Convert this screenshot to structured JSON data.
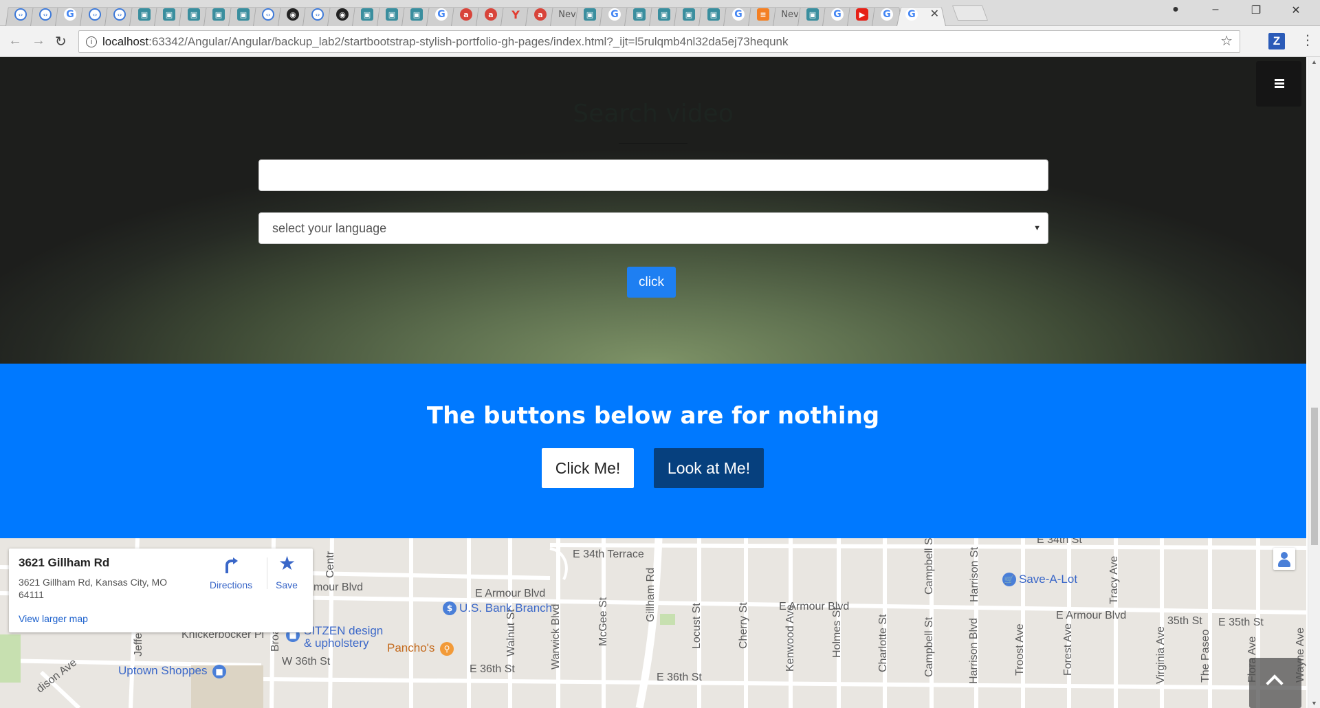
{
  "browser": {
    "tabs_count": 36,
    "tab_icons": [
      "code",
      "code",
      "g",
      "code",
      "code",
      "img",
      "img",
      "img",
      "img",
      "img",
      "code",
      "github",
      "code",
      "github",
      "img",
      "img",
      "img",
      "g",
      "avast",
      "avast",
      "y",
      "avast",
      "new",
      "img",
      "g",
      "img",
      "img",
      "img",
      "img",
      "g",
      "so",
      "new",
      "img",
      "g",
      "youtube",
      "g"
    ],
    "new_tab_label": "Nev",
    "active_tab_close": "✕",
    "url_host": "localhost",
    "url_path": ":63342/Angular/Angular/backup_lab2/startbootstrap-stylish-portfolio-gh-pages/index.html?_ijt=l5rulqmb4nl32da5ej73hequnk",
    "extension_label": "Z"
  },
  "search": {
    "title": "Search video",
    "input_value": "",
    "language_select": "select your language",
    "submit_label": "click"
  },
  "cta": {
    "headline": "The buttons below are for nothing",
    "button_primary": "Click Me!",
    "button_secondary": "Look at Me!"
  },
  "map": {
    "place_name": "3621 Gillham Rd",
    "place_address": "3621 Gillham Rd, Kansas City, MO 64111",
    "view_larger": "View larger map",
    "directions_label": "Directions",
    "save_label": "Save",
    "streets": {
      "e34terrace": "E 34th Terrace",
      "e34st": "E 34th St",
      "armour1": "E Armour Blvd",
      "armour2": "E Armour Blvd",
      "armour3": "E Armour Blvd",
      "armour_left": "mour Blvd",
      "e35st_a": "35th St",
      "e35st_b": "E 35th St",
      "w36st": "W 36th St",
      "e36st": "E 36th St",
      "e36st_b": "E 36th St",
      "knickerbocker": "Knickerbocker Pl",
      "jefferson": "Jefferson",
      "broadway": "Broadwa",
      "central": "Centr",
      "walnut": "Walnut St",
      "warwick": "Warwick Blvd",
      "mcgee": "McGee St",
      "gillham": "Gillham Rd",
      "locust": "Locust St",
      "cherry": "Cherry St",
      "kenwood": "Kenwood Ave",
      "holmes": "Holmes St",
      "charlotte": "Charlotte St",
      "campbell": "Campbell St",
      "campbell2": "Campbell S",
      "harrison_blvd": "Harrison Blvd",
      "harrison_st": "Harrison St",
      "troost": "Troost Ave",
      "forest": "Forest Ave",
      "tracy": "Tracy Ave",
      "virginia": "Virginia Ave",
      "paseo": "The Paseo",
      "flora": "Flora Ave",
      "wayne": "Wayne Ave",
      "madison": "dison Ave"
    },
    "pois": {
      "bank": "U.S. Bank Branch",
      "save_a_lot": "Save-A-Lot",
      "sitzen_1": "SITZEN design",
      "sitzen_2": "& upholstery",
      "panchos": "Pancho's",
      "uptown": "Uptown Shoppes"
    }
  }
}
